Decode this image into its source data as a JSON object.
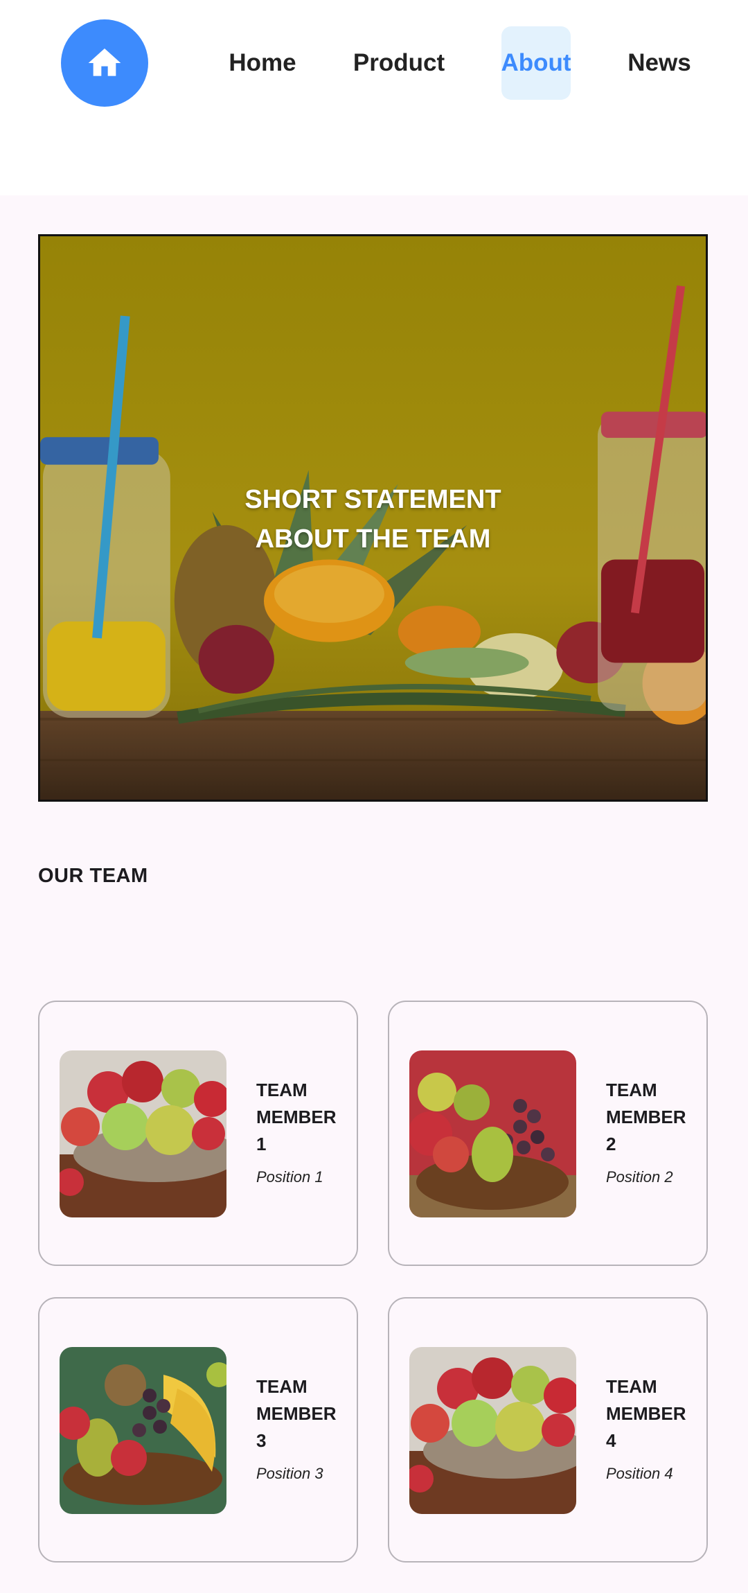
{
  "nav": {
    "home_icon": "home-icon",
    "items": [
      {
        "label": "Home"
      },
      {
        "label": "Product"
      },
      {
        "label": "About",
        "active": true
      },
      {
        "label": "News"
      }
    ]
  },
  "hero": {
    "line1": "SHORT STATEMENT",
    "line2": "ABOUT THE TEAM"
  },
  "team": {
    "title": "OUR TEAM",
    "members": [
      {
        "name_line1": "TEAM",
        "name_line2": "MEMBER",
        "name_line3": "1",
        "position": "Position 1",
        "image": "apple-basket"
      },
      {
        "name_line1": "TEAM",
        "name_line2": "MEMBER",
        "name_line3": "2",
        "position": "Position 2",
        "image": "pear-grape-basket"
      },
      {
        "name_line1": "TEAM",
        "name_line2": "MEMBER",
        "name_line3": "3",
        "position": "Position 3",
        "image": "mixed-fruit-basket"
      },
      {
        "name_line1": "TEAM",
        "name_line2": "MEMBER",
        "name_line3": "4",
        "position": "Position 4",
        "image": "apple-basket"
      }
    ]
  },
  "colors": {
    "accent": "#3d8bfd",
    "active_tab_bg": "#e3f2fd",
    "page_bg": "#fdf7fc",
    "hero_bg": "#a8950c"
  }
}
